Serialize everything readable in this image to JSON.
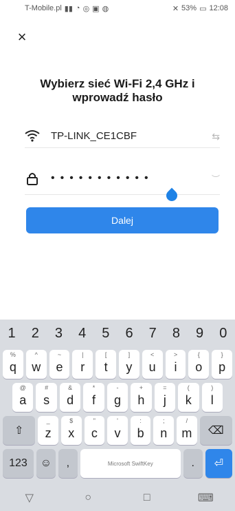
{
  "status_bar": {
    "carrier": "T-Mobile.pl",
    "battery": "53%",
    "time": "12:08"
  },
  "header": {
    "close_icon": "close-icon"
  },
  "title": "Wybierz sieć Wi-Fi 2,4 GHz i wprowadź hasło",
  "wifi": {
    "ssid": "TP-LINK_CE1CBF",
    "icon": "wifi-icon",
    "switch_icon": "swap-icon"
  },
  "password": {
    "masked_value": "•••••••••••",
    "icon": "lock-icon",
    "toggle_icon": "eye-icon"
  },
  "buttons": {
    "next": "Dalej"
  },
  "keyboard": {
    "numbers": [
      "1",
      "2",
      "3",
      "4",
      "5",
      "6",
      "7",
      "8",
      "9",
      "0"
    ],
    "row1": [
      {
        "key": "q",
        "alt": "%"
      },
      {
        "key": "w",
        "alt": "^"
      },
      {
        "key": "e",
        "alt": "~"
      },
      {
        "key": "r",
        "alt": "|"
      },
      {
        "key": "t",
        "alt": "["
      },
      {
        "key": "y",
        "alt": "]"
      },
      {
        "key": "u",
        "alt": "<"
      },
      {
        "key": "i",
        "alt": ">"
      },
      {
        "key": "o",
        "alt": "{"
      },
      {
        "key": "p",
        "alt": "}"
      }
    ],
    "row2": [
      {
        "key": "a",
        "alt": "@"
      },
      {
        "key": "s",
        "alt": "#"
      },
      {
        "key": "d",
        "alt": "&"
      },
      {
        "key": "f",
        "alt": "*"
      },
      {
        "key": "g",
        "alt": "-"
      },
      {
        "key": "h",
        "alt": "+"
      },
      {
        "key": "j",
        "alt": "="
      },
      {
        "key": "k",
        "alt": "("
      },
      {
        "key": "l",
        "alt": ")"
      }
    ],
    "row3": [
      {
        "key": "z",
        "alt": "_"
      },
      {
        "key": "x",
        "alt": "$"
      },
      {
        "key": "c",
        "alt": "\""
      },
      {
        "key": "v",
        "alt": "'"
      },
      {
        "key": "b",
        "alt": ":"
      },
      {
        "key": "n",
        "alt": ";"
      },
      {
        "key": "m",
        "alt": "/"
      }
    ],
    "row4": {
      "numbers_key": "123",
      "comma": ",",
      "space_label": "Microsoft SwiftKey",
      "period": "."
    }
  }
}
